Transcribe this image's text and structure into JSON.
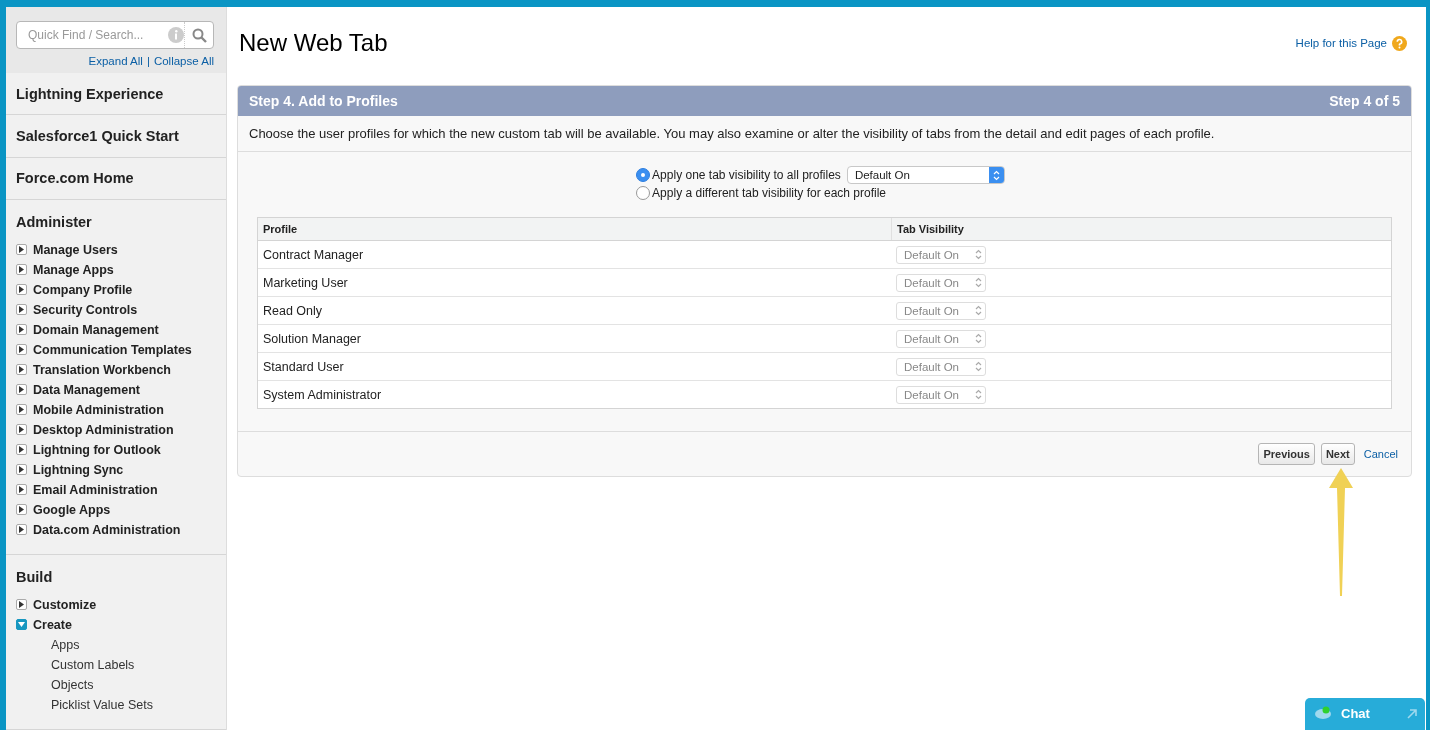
{
  "sidebar": {
    "search": {
      "placeholder": "Quick Find / Search..."
    },
    "expand_all": "Expand All",
    "separator": "|",
    "collapse_all": "Collapse All",
    "top_links": [
      "Lightning Experience",
      "Salesforce1 Quick Start",
      "Force.com Home"
    ],
    "sections": [
      {
        "title": "Administer",
        "items": [
          {
            "label": "Manage Users",
            "expanded": false
          },
          {
            "label": "Manage Apps",
            "expanded": false
          },
          {
            "label": "Company Profile",
            "expanded": false
          },
          {
            "label": "Security Controls",
            "expanded": false
          },
          {
            "label": "Domain Management",
            "expanded": false
          },
          {
            "label": "Communication Templates",
            "expanded": false
          },
          {
            "label": "Translation Workbench",
            "expanded": false
          },
          {
            "label": "Data Management",
            "expanded": false
          },
          {
            "label": "Mobile Administration",
            "expanded": false
          },
          {
            "label": "Desktop Administration",
            "expanded": false
          },
          {
            "label": "Lightning for Outlook",
            "expanded": false
          },
          {
            "label": "Lightning Sync",
            "expanded": false
          },
          {
            "label": "Email Administration",
            "expanded": false
          },
          {
            "label": "Google Apps",
            "expanded": false
          },
          {
            "label": "Data.com Administration",
            "expanded": false
          }
        ]
      },
      {
        "title": "Build",
        "items": [
          {
            "label": "Customize",
            "expanded": false
          },
          {
            "label": "Create",
            "expanded": true,
            "children": [
              {
                "label": "Apps"
              },
              {
                "label": "Custom Labels"
              },
              {
                "label": "Objects"
              },
              {
                "label": "Picklist Value Sets"
              }
            ]
          }
        ]
      }
    ]
  },
  "main": {
    "title": "New Web Tab",
    "help_link": "Help for this Page",
    "wizard": {
      "step_title": "Step 4. Add to Profiles",
      "step_count": "Step 4 of 5",
      "description": "Choose the user profiles for which the new custom tab will be available. You may also examine or alter the visibility of tabs from the detail and edit pages of each profile.",
      "radio_options": [
        {
          "label": "Apply one tab visibility to all profiles",
          "selected": true
        },
        {
          "label": "Apply a different tab visibility for each profile",
          "selected": false
        }
      ],
      "all_profiles_select": "Default On",
      "table": {
        "columns": [
          "Profile",
          "Tab Visibility"
        ],
        "rows": [
          {
            "profile": "Contract Manager",
            "visibility": "Default On",
            "disabled": true
          },
          {
            "profile": "Marketing User",
            "visibility": "Default On",
            "disabled": true
          },
          {
            "profile": "Read Only",
            "visibility": "Default On",
            "disabled": true
          },
          {
            "profile": "Solution Manager",
            "visibility": "Default On",
            "disabled": true
          },
          {
            "profile": "Standard User",
            "visibility": "Default On",
            "disabled": true
          },
          {
            "profile": "System Administrator",
            "visibility": "Default On",
            "disabled": true
          }
        ]
      },
      "buttons": [
        "Previous",
        "Next"
      ],
      "cancel_link": "Cancel"
    }
  },
  "chat": {
    "label": "Chat"
  }
}
